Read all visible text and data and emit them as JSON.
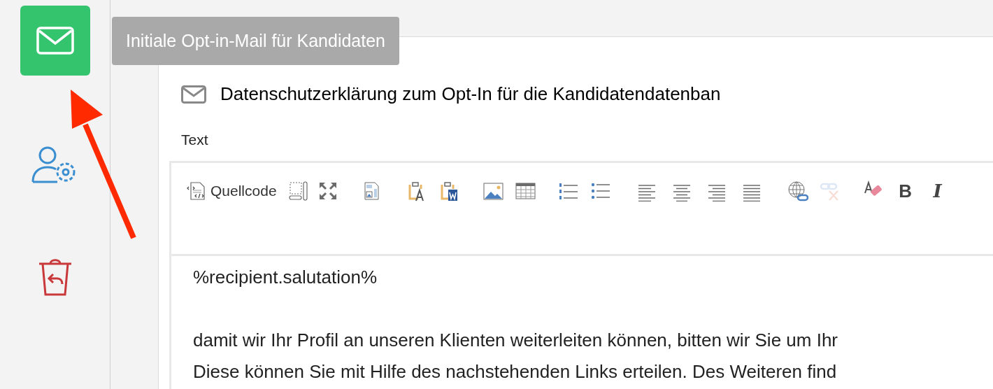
{
  "sidebar": {
    "items": [
      {
        "kind": "mail",
        "selected": true
      },
      {
        "kind": "user-settings",
        "selected": false
      },
      {
        "kind": "trash-restore",
        "selected": false
      }
    ]
  },
  "tooltip": "Initiale Opt-in-Mail für Kandidaten",
  "subject": {
    "value": "Datenschutzerklärung zum Opt-In für die Kandidatendatenban"
  },
  "text": {
    "label": "Text",
    "toolbar": [
      {
        "kind": "source",
        "label": "Quellcode"
      },
      {
        "kind": "autogrow"
      },
      {
        "kind": "maximize"
      },
      {
        "kind": "preview"
      },
      {
        "kind": "paste-text"
      },
      {
        "kind": "paste-word"
      },
      {
        "kind": "image"
      },
      {
        "kind": "table"
      },
      {
        "kind": "numbered-list"
      },
      {
        "kind": "bulleted-list"
      },
      {
        "kind": "align-left"
      },
      {
        "kind": "align-center"
      },
      {
        "kind": "align-right"
      },
      {
        "kind": "justify"
      },
      {
        "kind": "link"
      },
      {
        "kind": "unlink",
        "disabled": true
      },
      {
        "kind": "remove-format"
      },
      {
        "kind": "bold",
        "label": "B"
      },
      {
        "kind": "italic",
        "label": "I"
      }
    ],
    "paragraphs": [
      [
        "%recipient.salutation%"
      ],
      [
        "damit wir Ihr Profil an unseren Klienten weiterleiten können, bitten wir Sie um Ihr",
        "Diese können Sie mit Hilfe des nachstehenden Links erteilen. Des Weiteren find"
      ]
    ]
  }
}
